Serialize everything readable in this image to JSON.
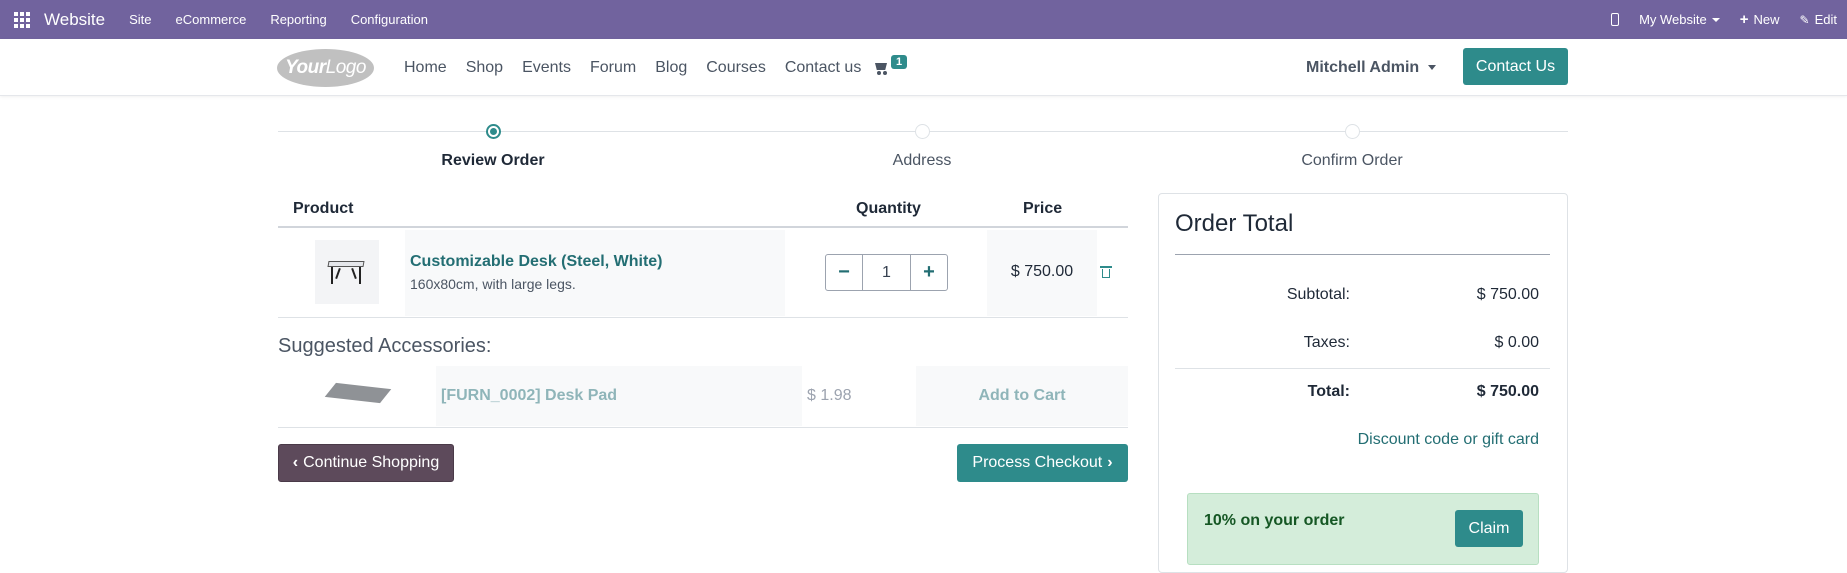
{
  "adminbar": {
    "brand": "Website",
    "menu": [
      "Site",
      "eCommerce",
      "Reporting",
      "Configuration"
    ],
    "website_switcher": "My Website",
    "new_label": "New",
    "edit_label": "Edit"
  },
  "header": {
    "logo_text_bold": "Your",
    "logo_text_light": "Logo",
    "nav": [
      "Home",
      "Shop",
      "Events",
      "Forum",
      "Blog",
      "Courses",
      "Contact us"
    ],
    "cart_count": "1",
    "user_name": "Mitchell Admin",
    "contact_button": "Contact Us"
  },
  "steps": [
    {
      "label": "Review Order",
      "active": true
    },
    {
      "label": "Address",
      "active": false
    },
    {
      "label": "Confirm Order",
      "active": false
    }
  ],
  "cart_table": {
    "headers": {
      "product": "Product",
      "quantity": "Quantity",
      "price": "Price"
    },
    "lines": [
      {
        "name": "Customizable Desk (Steel, White)",
        "description": "160x80cm, with large legs.",
        "quantity": "1",
        "price": "$ 750.00"
      }
    ]
  },
  "suggested": {
    "title": "Suggested Accessories:",
    "items": [
      {
        "name": "[FURN_0002] Desk Pad",
        "price": "$ 1.98",
        "add_label": "Add to Cart"
      }
    ]
  },
  "actions": {
    "continue": "Continue Shopping",
    "checkout": "Process Checkout"
  },
  "order_total": {
    "title": "Order Total",
    "subtotal_label": "Subtotal:",
    "subtotal": "$ 750.00",
    "taxes_label": "Taxes:",
    "taxes": "$ 0.00",
    "total_label": "Total:",
    "total": "$ 750.00",
    "discount_link": "Discount code or gift card",
    "promo_text": "10% on your order",
    "claim_label": "Claim"
  },
  "colors": {
    "admin_bar": "#71639e",
    "primary": "#2e8b8b",
    "secondary": "#5d4a5b",
    "promo_bg": "#d4edda"
  }
}
